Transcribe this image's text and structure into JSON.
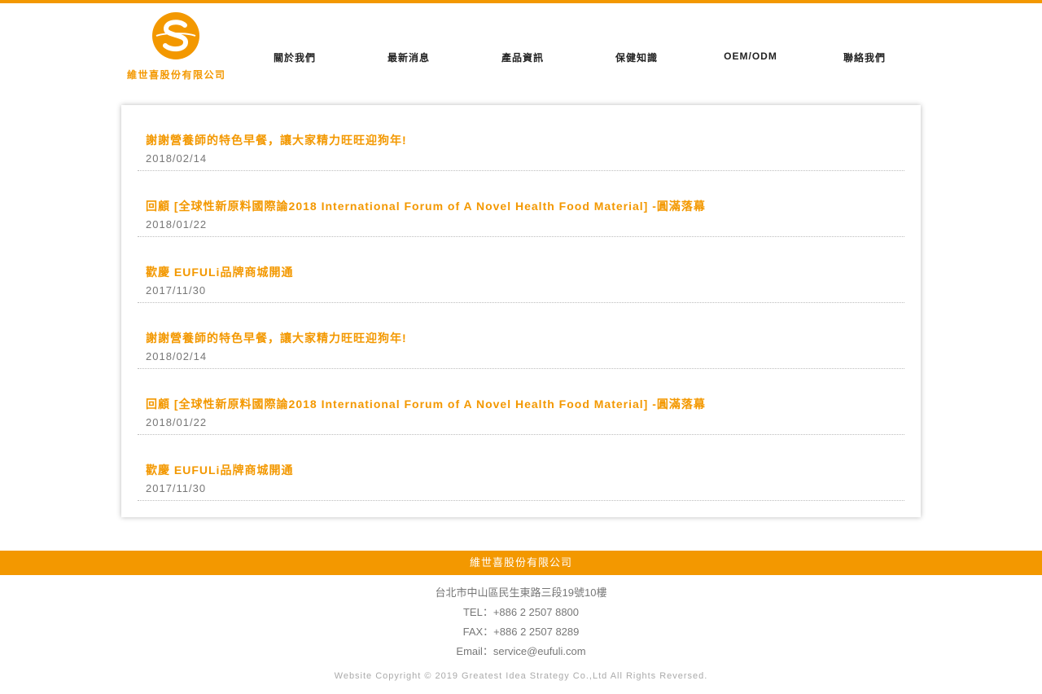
{
  "brand": {
    "name": "維世喜股份有限公司",
    "accent_color": "#f39800"
  },
  "nav": {
    "items": [
      {
        "label": "關於我們"
      },
      {
        "label": "最新消息"
      },
      {
        "label": "產品資訊"
      },
      {
        "label": "保健知識"
      },
      {
        "label": "OEM/ODM"
      },
      {
        "label": "聯絡我們"
      }
    ]
  },
  "news": [
    {
      "title": "謝謝營養師的特色早餐，讓大家精力旺旺迎狗年!",
      "date": "2018/02/14"
    },
    {
      "title": "回顧 [全球性新原料國際論2018 International Forum of A Novel Health Food Material] -圓滿落幕",
      "date": "2018/01/22"
    },
    {
      "title": "歡慶 EUFULi品牌商城開通",
      "date": "2017/11/30"
    },
    {
      "title": "謝謝營養師的特色早餐，讓大家精力旺旺迎狗年!",
      "date": "2018/02/14"
    },
    {
      "title": "回顧 [全球性新原料國際論2018 International Forum of A Novel Health Food Material] -圓滿落幕",
      "date": "2018/01/22"
    },
    {
      "title": "歡慶 EUFULi品牌商城開通",
      "date": "2017/11/30"
    }
  ],
  "footer": {
    "company": "維世喜股份有限公司",
    "address": "台北市中山區民生東路三段19號10樓",
    "tel": "TEL：+886 2 2507 8800",
    "fax": "FAX：+886 2 2507 8289",
    "email": "Email：service@eufuli.com",
    "copyright": "Website Copyright © 2019 Greatest Idea Strategy Co.,Ltd All Rights Reversed."
  }
}
